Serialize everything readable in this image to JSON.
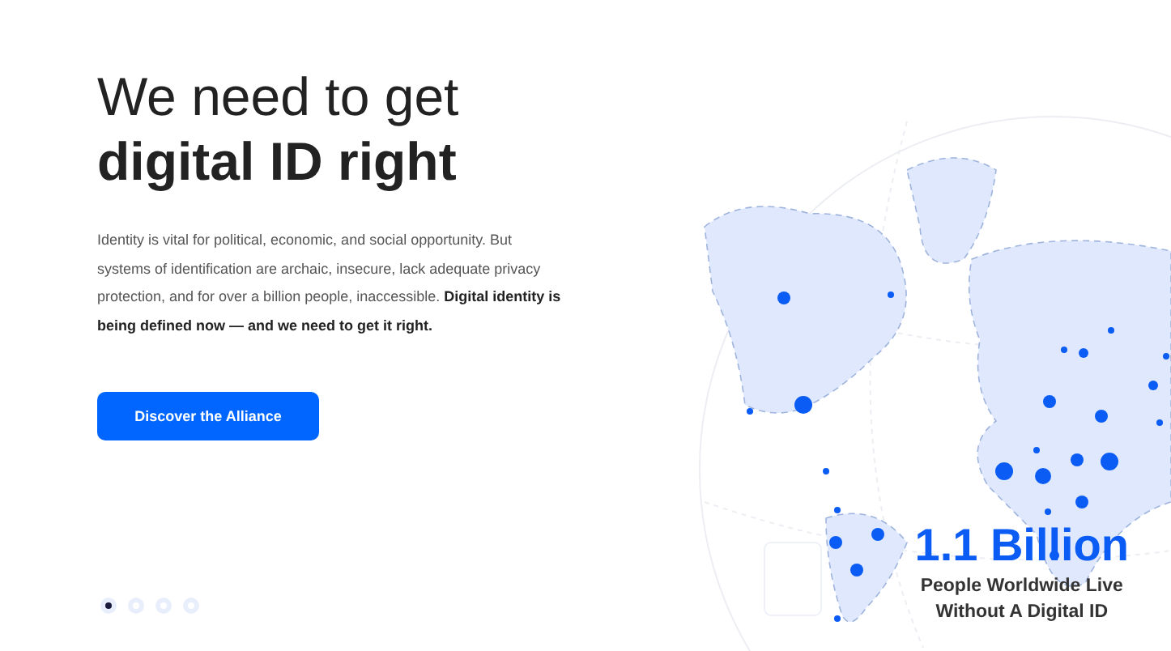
{
  "hero": {
    "heading_line_1": "We need to get",
    "heading_line_2": "digital ID right",
    "body": "Identity is vital for political, economic, and social opportunity. But systems of identification are archaic, insecure, lack adequate privacy protection, and for over a billion people, inaccessible. **Digital identity is being defined now — and we need to get it right.**",
    "button": "Discover the Alliance"
  },
  "slides": [
    {
      "selected": true
    },
    {
      "selected": false
    },
    {
      "selected": false
    },
    {
      "selected": false
    }
  ],
  "stat": {
    "value": "1.1 Billion",
    "caption_line_1": "People Worldwide Live",
    "caption_line_2": "Without A Digital ID"
  }
}
